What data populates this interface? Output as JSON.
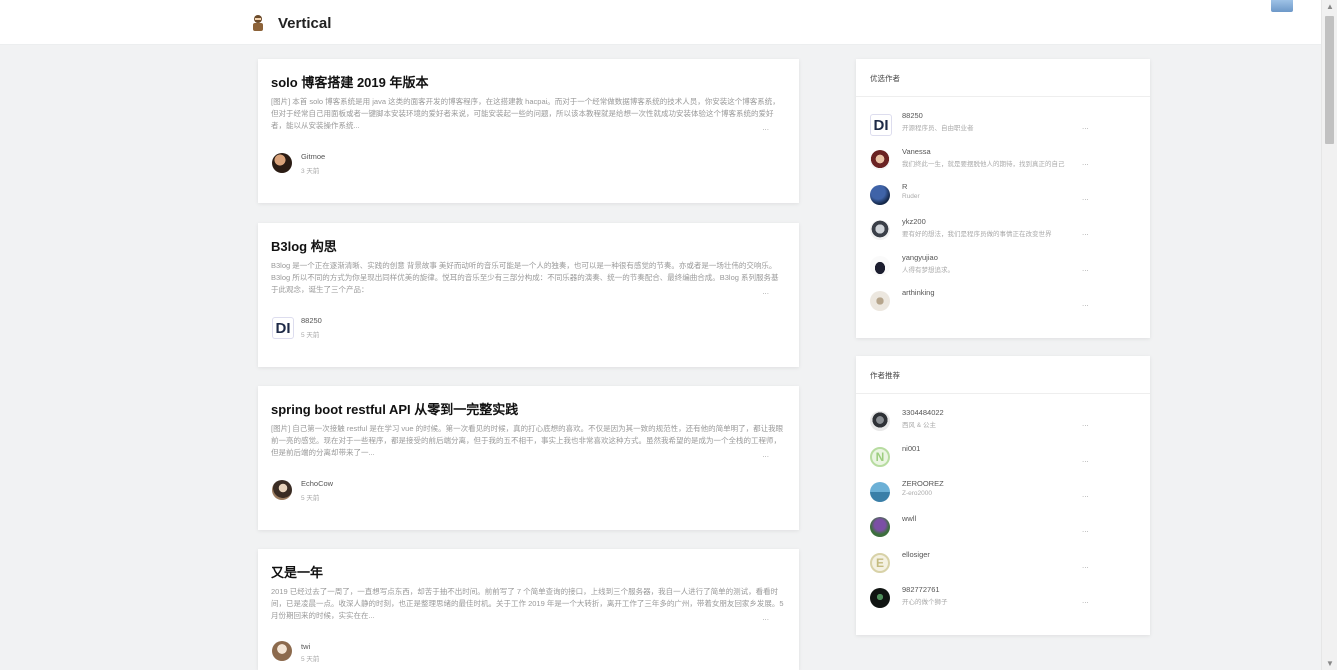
{
  "header": {
    "site_title": "Vertical",
    "logo_icon": "character-logo-icon",
    "corner_icon": "image-thumbnail-icon"
  },
  "posts": [
    {
      "title": "solo 博客搭建 2019 年版本",
      "abstract": "[图片] 本首 solo 博客系统是用 java 这类的面客开发的博客程序，在这搭建教 hacpai。而对于一个经常做数据博客系统的技术人员，你安装这个博客系统，但对于经常自己用面板或者一键脚本安装环境的爱好者来说，可能安装起一些的问题，所以该本教程就是给想一次性就成功安装体验这个博客系统的爱好者，能以从安装操作系统...",
      "more": "...",
      "author": "Gitmoe",
      "time": "3 天前"
    },
    {
      "title": "B3log 构思",
      "abstract": "B3log 是一个正在逐渐清晰、实践的创意 背景故事 美好而动听的音乐可能是一个人的独奏，也可以是一种很有感觉的节奏。亦或者是一场壮伟的交响乐。B3log 所以不同的方式为你呈现出同样优美的旋律。悦耳的音乐至少有三部分构成：不同乐器的演奏、统一的节奏配合、最终编曲合成。B3log 系列服务基于此观念，诞生了三个产品：",
      "more": "...",
      "author": "88250",
      "time": "5 天前"
    },
    {
      "title": "spring boot restful API 从零到一完整实践",
      "abstract": "[图片] 自己第一次接触 restful 是在学习 vue 的时候。第一次看见的时候，真的打心底想的喜欢。不仅是因为其一致的规范性，还有他的简单明了，都让我眼前一亮的感觉。现在对于一些程序，都是接受的前后端分离，但于我的五不相干，事实上我也非常喜欢这种方式。虽然我希望的是成为一个全栈的工程师，但是前后端的分离却带来了一...",
      "more": "...",
      "author": "EchoCow",
      "time": "5 天前"
    },
    {
      "title": "又是一年",
      "abstract": "2019 已经过去了一周了，一直想写点东西，却苦于抽不出时间。前前写了 7 个简单查询的接口，上线到三个服务器，我自一人进行了简单的测试，看看时间，已是凌晨一点。收深人静的时刻，也正是整理思绪的最佳时机。关于工作 2019 年是一个大转折，离开工作了三年多的广州，带着女朋友回家乡发展。5 月份期回来的时候，实实在在...",
      "more": "...",
      "author": "twi",
      "time": "5 天前"
    }
  ],
  "featured": {
    "title": "优选作者",
    "authors": [
      {
        "name": "88250",
        "desc": "开源程序员、自由职业者"
      },
      {
        "name": "Vanessa",
        "desc": "我们终此一生，就是要摆脱他人的期待，找到真正的自己"
      },
      {
        "name": "R",
        "desc": "Ruder"
      },
      {
        "name": "ykz200",
        "desc": "要有好的想法，我们是程序员做的事情正在改变世界"
      },
      {
        "name": "yangyujiao",
        "desc": "人得有梦想追求。"
      },
      {
        "name": "arthinking",
        "desc": ""
      }
    ]
  },
  "recommended": {
    "title": "作者推荐",
    "authors": [
      {
        "name": "3304484022",
        "desc": "西风 & 公主"
      },
      {
        "name": "ni001",
        "desc": ""
      },
      {
        "name": "ZEROOREZ",
        "desc": "Z-ero2000"
      },
      {
        "name": "wwll",
        "desc": ""
      },
      {
        "name": "ellosiger",
        "desc": ""
      },
      {
        "name": "982772761",
        "desc": "开心的做个狮子"
      }
    ]
  },
  "item_more": "..."
}
